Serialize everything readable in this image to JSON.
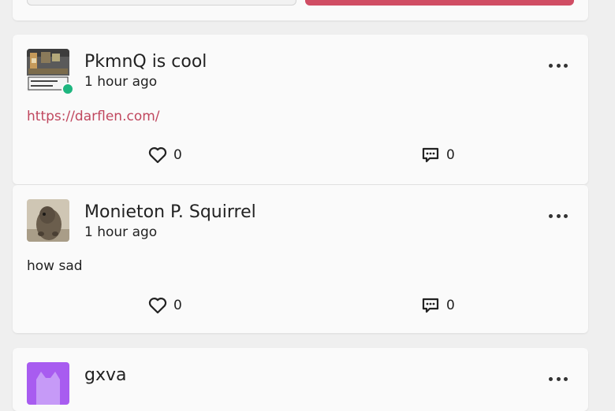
{
  "posts": [
    {
      "author": "PkmnQ is cool",
      "time": "1 hour ago",
      "link": "https://darflen.com/",
      "likes": "0",
      "comments": "0",
      "online": true
    },
    {
      "author": "Monieton P. Squirrel",
      "time": "1 hour ago",
      "text": "how sad",
      "likes": "0",
      "comments": "0"
    },
    {
      "author": "gxva"
    }
  ],
  "colors": {
    "accent": "#d04d64",
    "link": "#c0475e",
    "online": "#1eb67f",
    "card": "#fafafa",
    "background": "#efefef"
  },
  "icons": {
    "like": "heart-icon",
    "comment": "comment-icon",
    "more": "more-options-icon"
  }
}
